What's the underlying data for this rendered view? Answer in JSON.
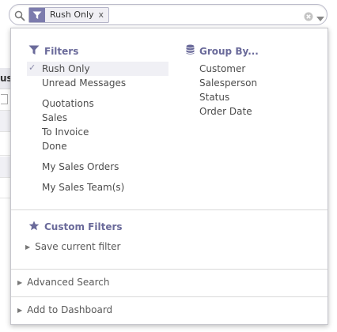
{
  "background": {
    "column_header": "us"
  },
  "search": {
    "facet_value": "Rush Only",
    "facet_remove": "x",
    "input_value": "",
    "input_placeholder": ""
  },
  "filters": {
    "title": "Filters",
    "items": [
      {
        "label": "Rush Only",
        "selected": true
      },
      {
        "label": "Unread Messages",
        "selected": false
      },
      {
        "label": "Quotations",
        "selected": false
      },
      {
        "label": "Sales",
        "selected": false
      },
      {
        "label": "To Invoice",
        "selected": false
      },
      {
        "label": "Done",
        "selected": false
      },
      {
        "label": "My Sales Orders",
        "selected": false
      },
      {
        "label": "My Sales Team(s)",
        "selected": false
      }
    ],
    "check_glyph": "✓"
  },
  "group_by": {
    "title": "Group By...",
    "items": [
      "Customer",
      "Salesperson",
      "Status",
      "Order Date"
    ]
  },
  "custom_filters": {
    "title": "Custom Filters",
    "save_label": "Save current filter"
  },
  "advanced_search": {
    "label": "Advanced Search"
  },
  "add_dashboard": {
    "label": "Add to Dashboard"
  },
  "colors": {
    "accent": "#7c7bad",
    "section_title": "#6a6a9a"
  },
  "icons": {
    "search": "search-icon",
    "facet_filter": "filter-icon",
    "clear": "clear-icon",
    "dropdown": "chevron-down-icon",
    "filters": "filter-icon",
    "group_by": "database-icon",
    "custom_filters": "star-icon",
    "caret": "caret-right-icon"
  }
}
